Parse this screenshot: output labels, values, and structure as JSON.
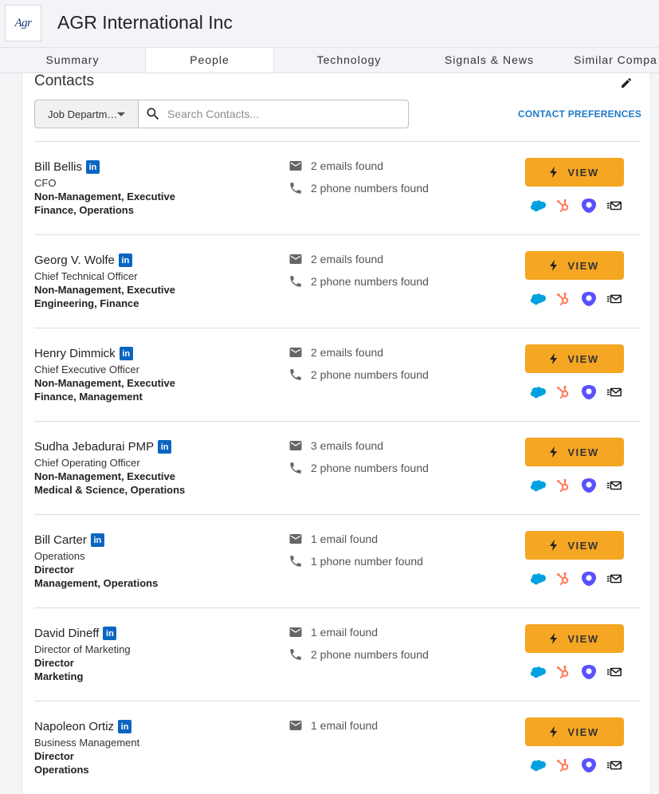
{
  "header": {
    "logo_text": "Agr",
    "company_name": "AGR International Inc"
  },
  "tabs": [
    {
      "label": "Summary"
    },
    {
      "label": "People"
    },
    {
      "label": "Technology"
    },
    {
      "label": "Signals & News"
    },
    {
      "label": "Similar Compa"
    }
  ],
  "active_tab": "People",
  "contacts": {
    "title": "Contacts",
    "filter_label": "Job Departm…",
    "search_placeholder": "Search Contacts...",
    "preferences_label": "CONTACT PREFERENCES",
    "view_label": "VIEW",
    "linkedin_label": "in",
    "rows": [
      {
        "name": "Bill Bellis",
        "title": "CFO",
        "level": "Non-Management, Executive",
        "departments": "Finance, Operations",
        "emails": "2 emails found",
        "phones": "2 phone numbers found"
      },
      {
        "name": "Georg V. Wolfe",
        "title": "Chief Technical Officer",
        "level": "Non-Management, Executive",
        "departments": "Engineering, Finance",
        "emails": "2 emails found",
        "phones": "2 phone numbers found"
      },
      {
        "name": "Henry Dimmick",
        "title": "Chief Executive Officer",
        "level": "Non-Management, Executive",
        "departments": "Finance, Management",
        "emails": "2 emails found",
        "phones": "2 phone numbers found"
      },
      {
        "name": "Sudha Jebadurai PMP",
        "title": "Chief Operating Officer",
        "level": "Non-Management, Executive",
        "departments": "Medical & Science, Operations",
        "emails": "3 emails found",
        "phones": "2 phone numbers found"
      },
      {
        "name": "Bill Carter",
        "title": "Operations",
        "level": "Director",
        "departments": "Management, Operations",
        "emails": "1 email found",
        "phones": "1 phone number found"
      },
      {
        "name": "David Dineff",
        "title": "Director of Marketing",
        "level": "Director",
        "departments": "Marketing",
        "emails": "1 email found",
        "phones": "2 phone numbers found"
      },
      {
        "name": "Napoleon Ortiz",
        "title": "Business Management",
        "level": "Director",
        "departments": "Operations",
        "emails": "1 email found",
        "phones": null
      }
    ]
  },
  "colors": {
    "view_button": "#f5a623",
    "linkedin": "#0a66c2",
    "link": "#1f7ac7",
    "salesforce": "#00a1e0",
    "hubspot": "#ff7a59",
    "outreach": "#5951ff"
  },
  "integration_icons": [
    "salesforce-icon",
    "hubspot-icon",
    "outreach-icon",
    "email-sequence-icon"
  ]
}
